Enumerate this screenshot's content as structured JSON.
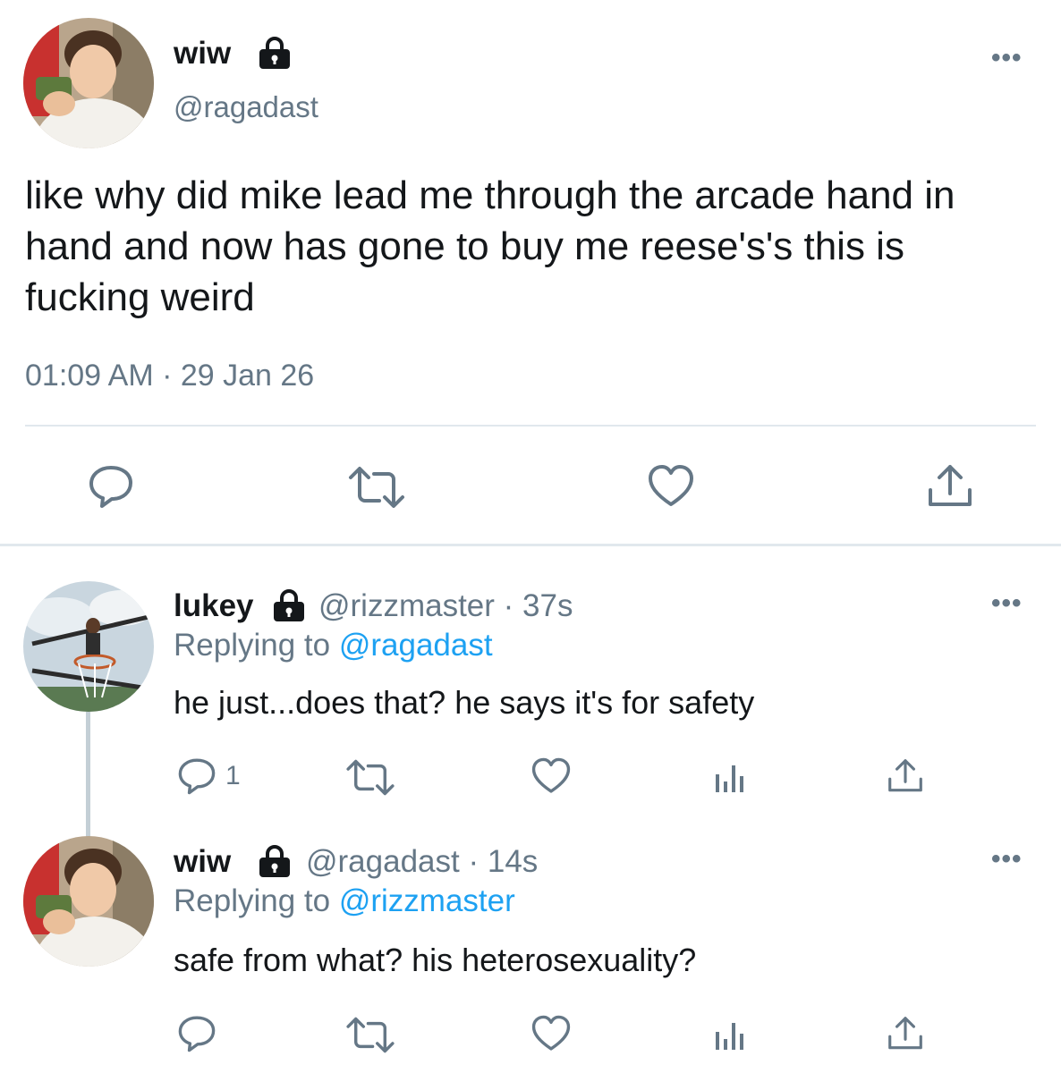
{
  "main_tweet": {
    "display_name": "wiw",
    "handle": "@ragadast",
    "text": "like why did mike lead me through the arcade hand in hand and now has gone to buy me reese's's this is fucking weird",
    "timestamp": "01:09 AM · 29 Jan 26",
    "icons": [
      "lock-icon",
      "more-icon",
      "reply-icon",
      "retweet-icon",
      "like-icon",
      "share-icon"
    ]
  },
  "replies": [
    {
      "display_name": "lukey",
      "handle": "@rizzmaster",
      "time": "· 37s",
      "replying_prefix": "Replying to",
      "replying_to": "@ragadast",
      "text": "he just...does that? he says it's for safety",
      "reply_count": "1"
    },
    {
      "display_name": "wiw",
      "handle": "@ragadast",
      "time": "· 14s",
      "replying_prefix": "Replying to",
      "replying_to": "@rizzmaster",
      "text": "safe from what? his heterosexuality?",
      "reply_count": ""
    }
  ],
  "colors": {
    "text": "#14171a",
    "muted": "#657786",
    "link": "#1da1f2",
    "divider": "#e1e8ed"
  }
}
